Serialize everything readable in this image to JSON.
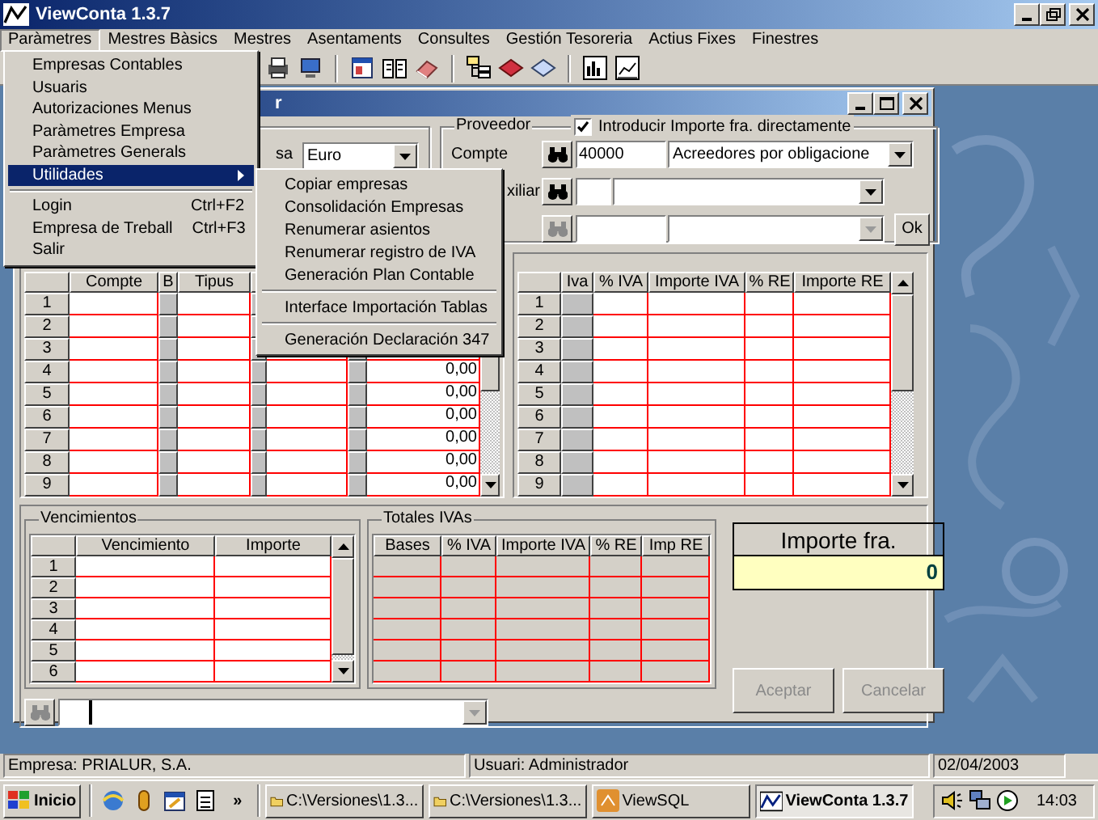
{
  "window": {
    "title": "ViewConta 1.3.7"
  },
  "menu_bar": [
    {
      "label": "Paràmetres",
      "selected": true
    },
    {
      "label": "Mestres Bàsics",
      "selected": false
    },
    {
      "label": "Mestres",
      "selected": false
    },
    {
      "label": "Asentaments",
      "selected": false
    },
    {
      "label": "Consultes",
      "selected": false
    },
    {
      "label": "Gestión Tesoreria",
      "selected": false
    },
    {
      "label": "Actius Fixes",
      "selected": false
    },
    {
      "label": "Finestres",
      "selected": false
    }
  ],
  "open_menu": {
    "items": [
      {
        "kind": "item",
        "label": "Empresas Contables",
        "selected": false
      },
      {
        "kind": "item",
        "label": "Usuaris",
        "selected": false
      },
      {
        "kind": "item",
        "label": "Autorizaciones Menus",
        "selected": false
      },
      {
        "kind": "item",
        "label": "Paràmetres Empresa",
        "selected": false
      },
      {
        "kind": "item",
        "label": "Paràmetres Generals",
        "selected": false
      },
      {
        "kind": "submenu",
        "label": "Utilidades",
        "selected": true
      },
      {
        "kind": "separator"
      },
      {
        "kind": "item",
        "label": "Login",
        "shortcut": "Ctrl+F2",
        "selected": false
      },
      {
        "kind": "item",
        "label": "Empresa de Treball",
        "shortcut": "Ctrl+F3",
        "selected": false
      },
      {
        "kind": "item",
        "label": "Salir",
        "selected": false
      }
    ]
  },
  "submenu": {
    "items": [
      {
        "kind": "item",
        "label": "Copiar empresas",
        "selected": false
      },
      {
        "kind": "item",
        "label": "Consolidación Empresas",
        "selected": false
      },
      {
        "kind": "item",
        "label": "Renumerar asientos",
        "selected": false
      },
      {
        "kind": "item",
        "label": "Renumerar registro de IVA",
        "selected": false
      },
      {
        "kind": "item",
        "label": "Generación Plan Contable",
        "selected": false
      },
      {
        "kind": "separator"
      },
      {
        "kind": "item",
        "label": "Interface Importación Tablas",
        "selected": false
      },
      {
        "kind": "separator"
      },
      {
        "kind": "item",
        "label": "Generación Declaración 347",
        "selected": false
      }
    ]
  },
  "child_window": {
    "title": "r",
    "currency": {
      "label": "sa",
      "value": "Euro"
    },
    "proveedor": {
      "legend": "Proveedor",
      "direct_amount": {
        "label": "Introducir Importe fra. directamente",
        "checked": true
      },
      "rows": [
        {
          "label": "Compte",
          "code": "40000",
          "name": "Acreedores por obligacione",
          "disabled": false
        },
        {
          "label": "xiliar",
          "disabled": false
        },
        {
          "disabled": true
        }
      ],
      "ok_button": "Ok"
    },
    "lines_grid": {
      "columns": [
        "Compte",
        "B",
        "Tipus"
      ],
      "rows": [
        {
          "number": "1"
        },
        {
          "number": "2"
        },
        {
          "number": "3"
        },
        {
          "number": "4",
          "amount": "0,00"
        },
        {
          "number": "5",
          "amount": "0,00"
        },
        {
          "number": "6",
          "amount": "0,00"
        },
        {
          "number": "7",
          "amount": "0,00"
        },
        {
          "number": "8",
          "amount": "0,00"
        },
        {
          "number": "9",
          "amount": "0,00"
        }
      ]
    },
    "iva_grid": {
      "columns": [
        "Iva",
        "% IVA",
        "Importe IVA",
        "% RE",
        "Importe RE"
      ],
      "rows": [
        "1",
        "2",
        "3",
        "4",
        "5",
        "6",
        "7",
        "8",
        "9"
      ]
    },
    "vencimientos": {
      "legend": "Vencimientos",
      "columns": [
        "Vencimiento",
        "Importe"
      ],
      "rows": [
        "1",
        "2",
        "3",
        "4",
        "5",
        "6"
      ]
    },
    "totales_ivas": {
      "legend": "Totales IVAs",
      "columns": [
        "Bases",
        "% IVA",
        "Importe IVA",
        "% RE",
        "Imp RE"
      ]
    },
    "importe_fra": {
      "label": "Importe fra.",
      "value": "0"
    },
    "lookup": {
      "disabled": true
    },
    "buttons": [
      {
        "label": "Aceptar",
        "disabled": true
      },
      {
        "label": "Cancelar",
        "disabled": true
      }
    ]
  },
  "status_bar": [
    "Empresa: PRIALUR, S.A.",
    "Usuari: Administrador",
    "02/04/2003"
  ],
  "taskbar": {
    "start": "Inicio",
    "more": "»",
    "tasks": [
      {
        "label": "C:\\Versiones\\1.3...",
        "selected": false
      },
      {
        "label": "C:\\Versiones\\1.3...",
        "selected": false
      },
      {
        "label": "ViewSQL",
        "selected": false
      },
      {
        "label": "ViewConta 1.3.7",
        "selected": true
      }
    ],
    "clock": "14:03"
  }
}
